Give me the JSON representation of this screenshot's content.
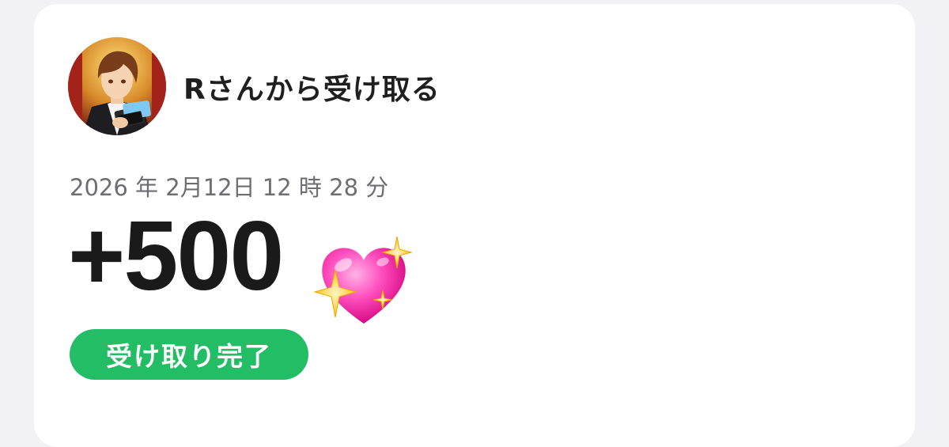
{
  "transaction": {
    "sender_label": "Rさんから受け取る",
    "timestamp": "2026 年 2月12日 12 時 28 分",
    "amount": "+500",
    "amount_emoji_icon": "sparkling-heart-icon",
    "status": "受け取り完了"
  },
  "colors": {
    "background": "#f2f2f4",
    "card": "#ffffff",
    "status_green": "#22bd65",
    "heart_pink": "#ff3fb4",
    "sparkle_yellow": "#ffd84a"
  }
}
